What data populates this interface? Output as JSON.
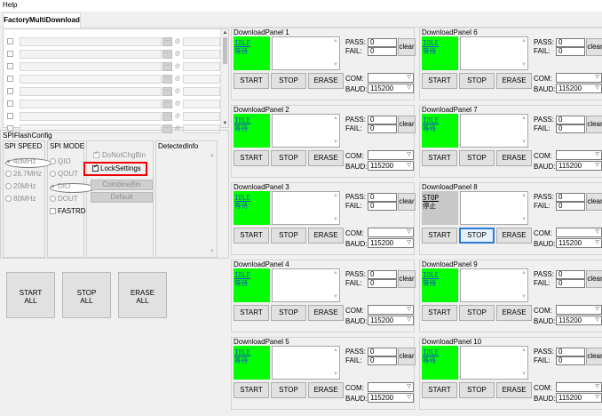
{
  "menu": {
    "help": "Help"
  },
  "tab": {
    "label": "FactoryMultiDownload"
  },
  "spi": {
    "title": "SPIFlashConfig",
    "speed_title": "SPI SPEED",
    "mode_title": "SPI MODE",
    "speeds": [
      "40MHz",
      "26.7MHz",
      "20MHz",
      "80MHz"
    ],
    "modes": [
      "QIO",
      "QOUT",
      "DIO",
      "DOUT",
      "FASTRD"
    ],
    "donotchgbin": "DoNotChgBin",
    "locksettings": "LockSettings",
    "combinebin": "CombineBin",
    "default": "Default",
    "detected": "DetectedInfo"
  },
  "bottom_buttons": {
    "start_all": [
      "START",
      "ALL"
    ],
    "stop_all": [
      "STOP",
      "ALL"
    ],
    "erase_all": [
      "ERASE",
      "ALL"
    ]
  },
  "panel_common": {
    "pass": "PASS:",
    "fail": "FAIL:",
    "pass_value": "0",
    "fail_value": "0",
    "clear": "clear",
    "com": "COM:",
    "baud": "BAUD:",
    "baud_value": "115200",
    "start": "START",
    "stop": "STOP",
    "erase": "ERASE"
  },
  "panels": [
    {
      "title": "DownloadPanel 1",
      "status_en": "IDLE",
      "status_cn": "等待"
    },
    {
      "title": "DownloadPanel 6",
      "status_en": "IDLE",
      "status_cn": "等待"
    },
    {
      "title": "DownloadPanel 2",
      "status_en": "IDLE",
      "status_cn": "等待"
    },
    {
      "title": "DownloadPanel 7",
      "status_en": "IDLE",
      "status_cn": "等待"
    },
    {
      "title": "DownloadPanel 3",
      "status_en": "IDLE",
      "status_cn": "等待"
    },
    {
      "title": "DownloadPanel 8",
      "status_en": "STOP",
      "status_cn": "停止"
    },
    {
      "title": "DownloadPanel 4",
      "status_en": "IDLE",
      "status_cn": "等待"
    },
    {
      "title": "DownloadPanel 9",
      "status_en": "IDLE",
      "status_cn": "等待"
    },
    {
      "title": "DownloadPanel 5",
      "status_en": "IDLE",
      "status_cn": "等待"
    },
    {
      "title": "DownloadPanel 10",
      "status_en": "IDLE",
      "status_cn": "等待"
    }
  ],
  "colors": {
    "idle": "#00ff00",
    "stopped": "#c8c8c8",
    "highlight": "#e00000"
  }
}
